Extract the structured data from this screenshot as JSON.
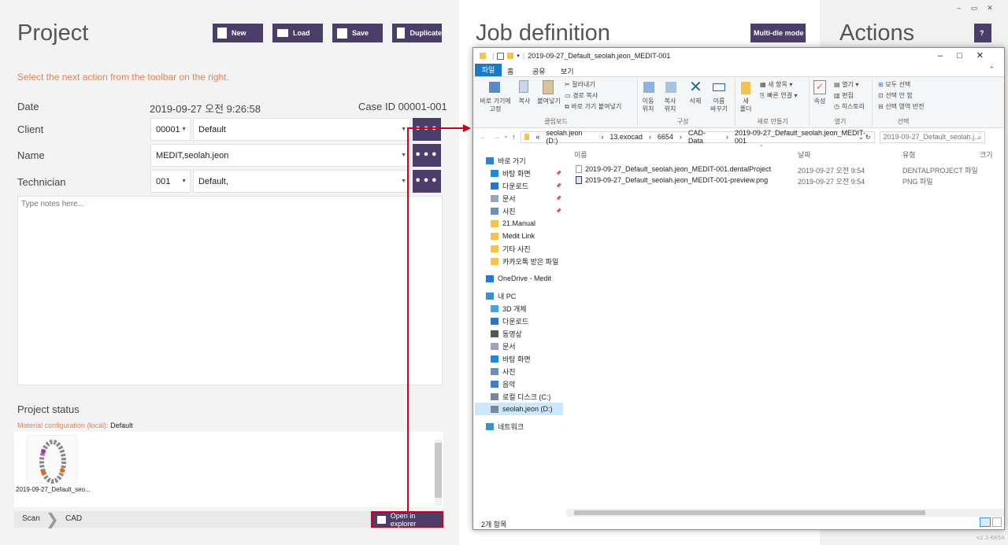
{
  "project": {
    "title": "Project",
    "hint": "Select the next action from the toolbar on the right.",
    "buttons": {
      "new": "New",
      "load": "Load",
      "save": "Save",
      "duplicate": "Duplicate"
    },
    "date_label": "Date",
    "date_value": "2019-09-27  오전 9:26:58",
    "case_label": "Case ID  00001-001",
    "client_label": "Client",
    "client_id": "00001",
    "client_name": "Default",
    "name_label": "Name",
    "name_value": "MEDIT,seolah.jeon",
    "tech_label": "Technician",
    "tech_id": "001",
    "tech_name": "Default,",
    "more": "•••",
    "notes_placeholder": "Type notes here...",
    "status_title": "Project status",
    "material_label": "Material configuration (local):",
    "material_value": "Default",
    "thumb_label": "2019-09-27_Default_seo...",
    "crumb_scan": "Scan",
    "crumb_cad": "CAD",
    "open_explorer": "Open in explorer"
  },
  "job": {
    "title": "Job definition",
    "multi_die": "Multi-die mode"
  },
  "actions": {
    "title": "Actions",
    "help": "?",
    "version": "v2.2-6654"
  },
  "explorer": {
    "title": "2019-09-27_Default_seolah.jeon_MEDIT-001",
    "tabs": [
      "파일",
      "홈",
      "공유",
      "보기"
    ],
    "ribbon": {
      "pin": "바로 가기에\n고정",
      "copy": "복사",
      "paste": "붙여넣기",
      "cut": "잘라내기",
      "copy_path": "경로 복사",
      "paste_shortcut": "바로 가기 붙여넣기",
      "clipboard": "클립보드",
      "move_to": "이동\n위치",
      "copy_to": "복사\n위치",
      "delete": "삭제",
      "rename": "이름\n바꾸기",
      "organize": "구성",
      "new_folder": "새\n폴더",
      "new_item": "새 항목",
      "easy_access": "빠른 연결",
      "new_group": "새로 만들기",
      "properties": "속성",
      "open": "열기",
      "edit": "편집",
      "history": "히스토리",
      "open_group": "열기",
      "select_all": "모두 선택",
      "select_none": "선택 안 함",
      "invert": "선택 영역 반전",
      "select_group": "선택"
    },
    "path": [
      "«",
      "seolah.jeon (D:)",
      "13.exocad",
      "6654",
      "CAD-Data",
      "2019-09-27_Default_seolah.jeon_MEDIT-001"
    ],
    "search_placeholder": "2019-09-27_Default_seolah.j...",
    "columns": {
      "name": "이름",
      "date": "날짜",
      "type": "유형",
      "size": "크기"
    },
    "files": [
      {
        "name": "2019-09-27_Default_seolah.jeon_MEDIT-001.dentalProject",
        "date": "2019-09-27 오전 9:54",
        "type": "DENTALPROJECT 파일"
      },
      {
        "name": "2019-09-27_Default_seolah.jeon_MEDIT-001-preview.png",
        "date": "2019-09-27 오전 9:54",
        "type": "PNG 파일"
      }
    ],
    "nav": [
      {
        "label": "바로 가기",
        "icon": "star-icon",
        "color": "#2f7fd5",
        "indent": 0,
        "gap": 0
      },
      {
        "label": "바탕 화면",
        "icon": "desktop-icon",
        "color": "#1f8ad6",
        "indent": 1,
        "pin": true
      },
      {
        "label": "다운로드",
        "icon": "download-icon",
        "color": "#2a74c9",
        "indent": 1,
        "pin": true
      },
      {
        "label": "문서",
        "icon": "document-icon",
        "color": "#9aa6b5",
        "indent": 1,
        "pin": true
      },
      {
        "label": "사진",
        "icon": "picture-icon",
        "color": "#6e8fb5",
        "indent": 1,
        "pin": true
      },
      {
        "label": "21.Manual",
        "icon": "folder-icon",
        "color": "#f3c34b",
        "indent": 1
      },
      {
        "label": "Medit Link",
        "icon": "folder-icon",
        "color": "#f3c34b",
        "indent": 1
      },
      {
        "label": "기타 사진",
        "icon": "folder-icon",
        "color": "#f3c34b",
        "indent": 1
      },
      {
        "label": "카카오톡 받은 파일",
        "icon": "folder-icon",
        "color": "#f3c34b",
        "indent": 1
      },
      {
        "label": "OneDrive - Medit",
        "icon": "cloud-icon",
        "color": "#1f7ad8",
        "indent": 0,
        "gap": 1
      },
      {
        "label": "내 PC",
        "icon": "pc-icon",
        "color": "#3a8ed8",
        "indent": 0,
        "gap": 1
      },
      {
        "label": "3D 개체",
        "icon": "cube-icon",
        "color": "#4aa3df",
        "indent": 1
      },
      {
        "label": "다운로드",
        "icon": "download-icon",
        "color": "#2a74c9",
        "indent": 1
      },
      {
        "label": "동영상",
        "icon": "video-icon",
        "color": "#555",
        "indent": 1
      },
      {
        "label": "문서",
        "icon": "document-icon",
        "color": "#9aa6b5",
        "indent": 1
      },
      {
        "label": "바탕 화면",
        "icon": "desktop-icon",
        "color": "#1f8ad6",
        "indent": 1
      },
      {
        "label": "사진",
        "icon": "picture-icon",
        "color": "#6e8fb5",
        "indent": 1
      },
      {
        "label": "음악",
        "icon": "music-icon",
        "color": "#3e7fc6",
        "indent": 1
      },
      {
        "label": "로컬 디스크 (C:)",
        "icon": "drive-icon",
        "color": "#7a8896",
        "indent": 1
      },
      {
        "label": "seolah.jeon (D:)",
        "icon": "drive-icon",
        "color": "#7a8896",
        "indent": 1,
        "selected": true
      },
      {
        "label": "네트워크",
        "icon": "network-icon",
        "color": "#3a8ed8",
        "indent": 0,
        "gap": 1
      }
    ],
    "status": "2개 항목"
  },
  "colors": {
    "accent": "#4c3e6b",
    "hint": "#e8834f",
    "arrow": "#d0021b"
  }
}
